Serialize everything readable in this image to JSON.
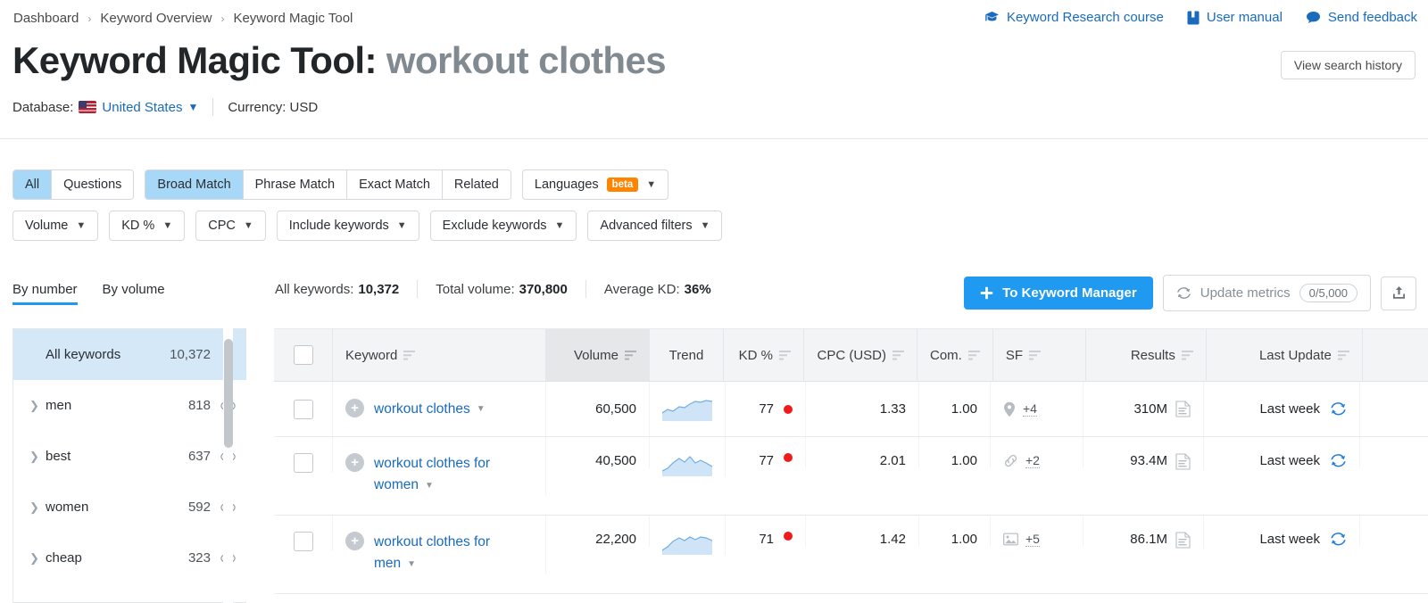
{
  "breadcrumb": {
    "items": [
      "Dashboard",
      "Keyword Overview",
      "Keyword Magic Tool"
    ],
    "separator": "›"
  },
  "toplinks": [
    {
      "label": "Keyword Research course",
      "icon": "graduation-cap-icon"
    },
    {
      "label": "User manual",
      "icon": "book-icon"
    },
    {
      "label": "Send feedback",
      "icon": "speech-bubble-icon"
    }
  ],
  "header": {
    "title_prefix": "Keyword Magic Tool:",
    "title_keyword": "workout clothes",
    "view_history_label": "View search history",
    "database_label": "Database:",
    "database_value": "United States",
    "currency_label": "Currency: USD"
  },
  "filters": {
    "match_group_1": [
      {
        "label": "All",
        "active": true
      },
      {
        "label": "Questions",
        "active": false
      }
    ],
    "match_group_2": [
      {
        "label": "Broad Match",
        "active": true
      },
      {
        "label": "Phrase Match",
        "active": false
      },
      {
        "label": "Exact Match",
        "active": false
      },
      {
        "label": "Related",
        "active": false
      }
    ],
    "languages": {
      "label": "Languages",
      "badge": "beta"
    },
    "row2": [
      "Volume",
      "KD %",
      "CPC",
      "Include keywords",
      "Exclude keywords",
      "Advanced filters"
    ]
  },
  "stats": [
    {
      "label": "All keywords:",
      "value": "10,372"
    },
    {
      "label": "Total volume:",
      "value": "370,800"
    },
    {
      "label": "Average KD:",
      "value": "36%"
    }
  ],
  "actions": {
    "to_keyword_manager": "To Keyword Manager",
    "update_metrics": "Update metrics",
    "update_counter": "0/5,000",
    "export_icon": "export-icon"
  },
  "sidebar": {
    "tabs": [
      {
        "label": "By number",
        "active": true
      },
      {
        "label": "By volume",
        "active": false
      }
    ],
    "rows": [
      {
        "name": "All keywords",
        "count": "10,372",
        "selected": true,
        "expandable": false,
        "eye": false
      },
      {
        "name": "men",
        "count": "818",
        "selected": false,
        "expandable": true,
        "eye": true
      },
      {
        "name": "best",
        "count": "637",
        "selected": false,
        "expandable": true,
        "eye": true
      },
      {
        "name": "women",
        "count": "592",
        "selected": false,
        "expandable": true,
        "eye": true
      },
      {
        "name": "cheap",
        "count": "323",
        "selected": false,
        "expandable": true,
        "eye": true
      }
    ]
  },
  "table": {
    "columns": [
      {
        "key": "checkbox",
        "label": "",
        "sortable": false,
        "sorted": false,
        "align": "c"
      },
      {
        "key": "keyword",
        "label": "Keyword",
        "sortable": true,
        "sorted": false,
        "align": "l"
      },
      {
        "key": "volume",
        "label": "Volume",
        "sortable": true,
        "sorted": true,
        "align": "r"
      },
      {
        "key": "trend",
        "label": "Trend",
        "sortable": false,
        "sorted": false,
        "align": "c"
      },
      {
        "key": "kd",
        "label": "KD %",
        "sortable": true,
        "sorted": false,
        "align": "r"
      },
      {
        "key": "cpc",
        "label": "CPC (USD)",
        "sortable": true,
        "sorted": false,
        "align": "r"
      },
      {
        "key": "com",
        "label": "Com.",
        "sortable": true,
        "sorted": false,
        "align": "r"
      },
      {
        "key": "sf",
        "label": "SF",
        "sortable": true,
        "sorted": false,
        "align": "l"
      },
      {
        "key": "results",
        "label": "Results",
        "sortable": true,
        "sorted": false,
        "align": "r"
      },
      {
        "key": "update",
        "label": "Last Update",
        "sortable": true,
        "sorted": false,
        "align": "r"
      }
    ],
    "rows": [
      {
        "keyword": "workout clothes",
        "volume": "60,500",
        "kd": "77",
        "kd_color": "#ef1b1b",
        "cpc": "1.33",
        "com": "1.00",
        "sf_icon": "map-pin-icon",
        "sf_extra": "+4",
        "results": "310M",
        "update": "Last week",
        "trend": [
          0.35,
          0.42,
          0.38,
          0.52,
          0.48,
          0.62,
          0.72,
          0.7,
          0.74,
          0.73
        ],
        "wrap": false
      },
      {
        "keyword": "workout clothes for women",
        "volume": "40,500",
        "kd": "77",
        "kd_color": "#ef1b1b",
        "cpc": "2.01",
        "com": "1.00",
        "sf_icon": "link-icon",
        "sf_extra": "+2",
        "results": "93.4M",
        "update": "Last week",
        "trend": [
          0.22,
          0.34,
          0.52,
          0.7,
          0.6,
          0.78,
          0.6,
          0.66,
          0.58,
          0.46
        ],
        "wrap": true
      },
      {
        "keyword": "workout clothes for men",
        "volume": "22,200",
        "kd": "71",
        "kd_color": "#ef1b1b",
        "cpc": "1.42",
        "com": "1.00",
        "sf_icon": "image-icon",
        "sf_extra": "+5",
        "results": "86.1M",
        "update": "Last week",
        "trend": [
          0.18,
          0.34,
          0.56,
          0.7,
          0.62,
          0.74,
          0.66,
          0.72,
          0.7,
          0.62
        ],
        "wrap": true
      }
    ]
  },
  "colors": {
    "accent": "#1f9af0",
    "link": "#1a6bbd",
    "selected_row": "#d5e8f8",
    "beta": "#ff8400",
    "kd_dot": "#ef1b1b"
  }
}
